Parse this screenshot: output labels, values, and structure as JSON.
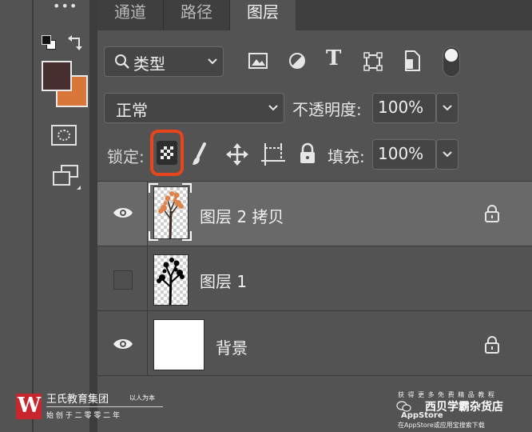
{
  "toolbar": {
    "more_label": "•••"
  },
  "tabs": [
    {
      "label": "通道"
    },
    {
      "label": "路径"
    },
    {
      "label": "图层"
    }
  ],
  "filter": {
    "kind_label": "类型"
  },
  "blend": {
    "mode": "正常",
    "opacity_label": "不透明度:",
    "opacity_value": "100%"
  },
  "lock": {
    "label": "锁定:",
    "fill_label": "填充:",
    "fill_value": "100%"
  },
  "layers": [
    {
      "name": "图层 2 拷贝"
    },
    {
      "name": "图层 1"
    },
    {
      "name": "背景"
    }
  ],
  "footer": {
    "brand_cn": "王氏教育集团",
    "brand_slogan": "以人为本",
    "brand_sub": "始 创 于 二 零 零 二 年",
    "promo_line1": "获 得 更 多 免 费 精 品 教 程",
    "promo_line2": "在AppStore或应用宝搜索下载",
    "wechat_name": "西贝学霸杂货店",
    "wechat_store": "AppStore"
  },
  "colors": {
    "foreground": "#472f2f",
    "background": "#d9763a",
    "highlight": "#e8441e"
  }
}
